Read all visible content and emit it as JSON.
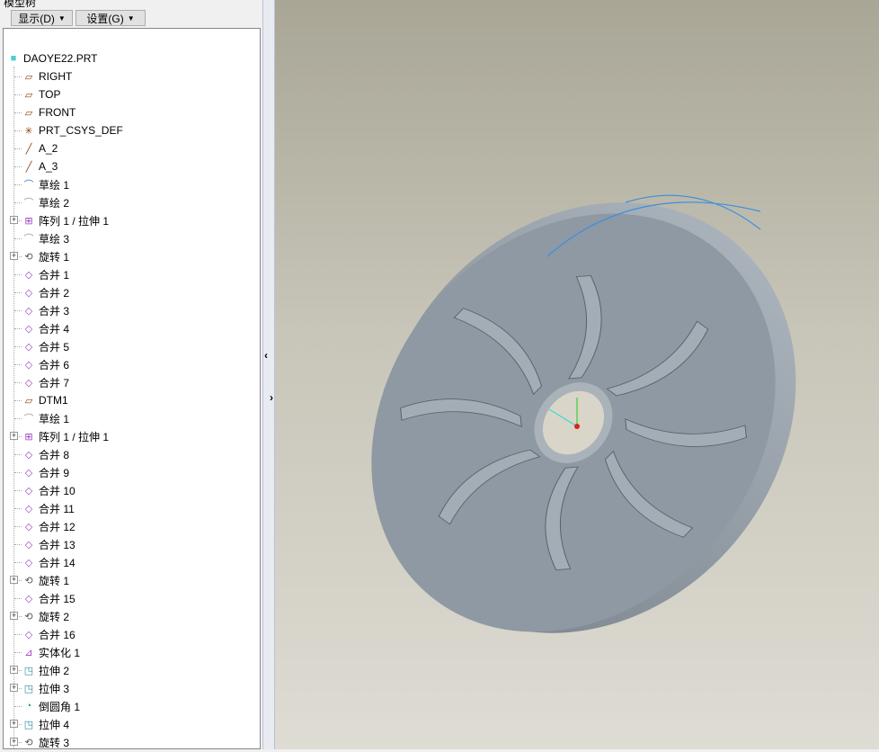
{
  "panel": {
    "title": "模型树",
    "show_label": "显示(D)",
    "settings_label": "设置(G)"
  },
  "tree": [
    {
      "label": "DAOYE22.PRT",
      "icon": "part",
      "root": true
    },
    {
      "label": "RIGHT",
      "icon": "plane"
    },
    {
      "label": "TOP",
      "icon": "plane"
    },
    {
      "label": "FRONT",
      "icon": "plane"
    },
    {
      "label": "PRT_CSYS_DEF",
      "icon": "csys"
    },
    {
      "label": "A_2",
      "icon": "axis"
    },
    {
      "label": "A_3",
      "icon": "axis"
    },
    {
      "label": "草绘 1",
      "icon": "sketch-active"
    },
    {
      "label": "草绘 2",
      "icon": "sketch"
    },
    {
      "label": "阵列 1 / 拉伸 1",
      "icon": "pattern",
      "expand": true
    },
    {
      "label": "草绘 3",
      "icon": "sketch"
    },
    {
      "label": "旋转 1",
      "icon": "revolve",
      "expand": true
    },
    {
      "label": "合并 1",
      "icon": "merge"
    },
    {
      "label": "合并 2",
      "icon": "merge"
    },
    {
      "label": "合并 3",
      "icon": "merge"
    },
    {
      "label": "合并 4",
      "icon": "merge"
    },
    {
      "label": "合并 5",
      "icon": "merge"
    },
    {
      "label": "合并 6",
      "icon": "merge"
    },
    {
      "label": "合并 7",
      "icon": "merge"
    },
    {
      "label": "DTM1",
      "icon": "plane"
    },
    {
      "label": "草绘 1",
      "icon": "sketch"
    },
    {
      "label": "阵列 1 / 拉伸 1",
      "icon": "pattern",
      "expand": true
    },
    {
      "label": "合并 8",
      "icon": "merge"
    },
    {
      "label": "合并 9",
      "icon": "merge"
    },
    {
      "label": "合并 10",
      "icon": "merge"
    },
    {
      "label": "合并 11",
      "icon": "merge"
    },
    {
      "label": "合并 12",
      "icon": "merge"
    },
    {
      "label": "合并 13",
      "icon": "merge"
    },
    {
      "label": "合并 14",
      "icon": "merge"
    },
    {
      "label": "旋转 1",
      "icon": "revolve",
      "expand": true
    },
    {
      "label": "合并 15",
      "icon": "merge"
    },
    {
      "label": "旋转 2",
      "icon": "revolve",
      "expand": true
    },
    {
      "label": "合并 16",
      "icon": "merge"
    },
    {
      "label": "实体化 1",
      "icon": "solidify"
    },
    {
      "label": "拉伸 2",
      "icon": "extrude",
      "expand": true
    },
    {
      "label": "拉伸 3",
      "icon": "extrude",
      "expand": true
    },
    {
      "label": "倒圆角 1",
      "icon": "round"
    },
    {
      "label": "拉伸 4",
      "icon": "extrude",
      "expand": true
    },
    {
      "label": "旋转 3",
      "icon": "revolve",
      "expand": true
    }
  ],
  "colors": {
    "viewport_top": "#a9a696",
    "viewport_bottom": "#dedcd3",
    "part": "#8f99a3"
  }
}
